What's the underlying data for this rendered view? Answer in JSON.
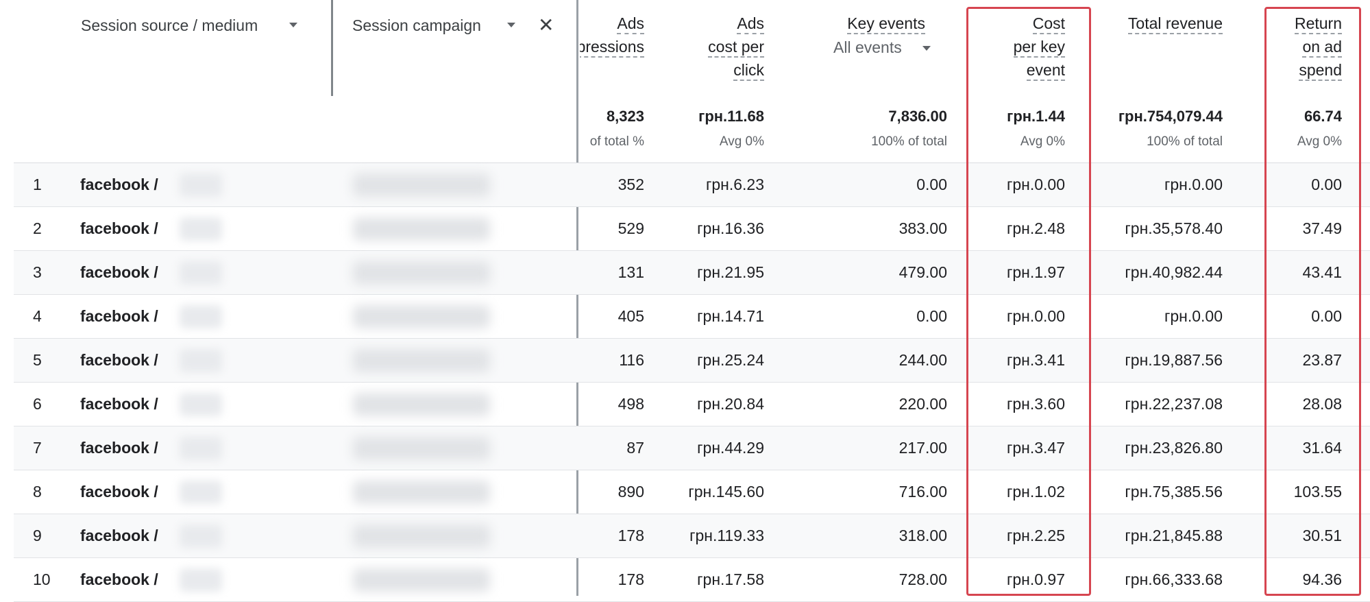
{
  "header": {
    "dim1_label": "Session source / medium",
    "dim2_label": "Session campaign",
    "remove_icon": "close-icon",
    "dropdown_icon": "caret-down-icon",
    "col_impressions": "pressions",
    "col_impressions_top": "Ads",
    "col_cpc": [
      "Ads",
      "cost per",
      "click"
    ],
    "col_key_events": "Key events",
    "key_events_selector": "All events",
    "col_cost_per_key": [
      "Cost",
      "per key",
      "event"
    ],
    "col_revenue": "Total revenue",
    "col_roas": [
      "Return",
      "on ad",
      "spend"
    ]
  },
  "totals": {
    "impressions": "8,323",
    "impressions_sub": "% of total",
    "cpc": "грн.11.68",
    "cpc_sub": "Avg 0%",
    "key_events": "7,836.00",
    "key_events_sub": "100% of total",
    "cost_per_key": "грн.1.44",
    "cost_per_key_sub": "Avg 0%",
    "revenue": "грн.754,079.44",
    "revenue_sub": "100% of total",
    "roas": "66.74",
    "roas_sub": "Avg 0%"
  },
  "rows": [
    {
      "n": "1",
      "source": "facebook /",
      "impressions": "352",
      "cpc": "грн.6.23",
      "key_events": "0.00",
      "cost_per_key": "грн.0.00",
      "revenue": "грн.0.00",
      "roas": "0.00"
    },
    {
      "n": "2",
      "source": "facebook /",
      "impressions": "529",
      "cpc": "грн.16.36",
      "key_events": "383.00",
      "cost_per_key": "грн.2.48",
      "revenue": "грн.35,578.40",
      "roas": "37.49"
    },
    {
      "n": "3",
      "source": "facebook /",
      "impressions": "131",
      "cpc": "грн.21.95",
      "key_events": "479.00",
      "cost_per_key": "грн.1.97",
      "revenue": "грн.40,982.44",
      "roas": "43.41"
    },
    {
      "n": "4",
      "source": "facebook /",
      "impressions": "405",
      "cpc": "грн.14.71",
      "key_events": "0.00",
      "cost_per_key": "грн.0.00",
      "revenue": "грн.0.00",
      "roas": "0.00"
    },
    {
      "n": "5",
      "source": "facebook /",
      "impressions": "116",
      "cpc": "грн.25.24",
      "key_events": "244.00",
      "cost_per_key": "грн.3.41",
      "revenue": "грн.19,887.56",
      "roas": "23.87"
    },
    {
      "n": "6",
      "source": "facebook /",
      "impressions": "498",
      "cpc": "грн.20.84",
      "key_events": "220.00",
      "cost_per_key": "грн.3.60",
      "revenue": "грн.22,237.08",
      "roas": "28.08"
    },
    {
      "n": "7",
      "source": "facebook /",
      "impressions": "87",
      "cpc": "грн.44.29",
      "key_events": "217.00",
      "cost_per_key": "грн.3.47",
      "revenue": "грн.23,826.80",
      "roas": "31.64"
    },
    {
      "n": "8",
      "source": "facebook /",
      "impressions": "890",
      "cpc": "грн.145.60",
      "key_events": "716.00",
      "cost_per_key": "грн.1.02",
      "revenue": "грн.75,385.56",
      "roas": "103.55"
    },
    {
      "n": "9",
      "source": "facebook /",
      "impressions": "178",
      "cpc": "грн.119.33",
      "key_events": "318.00",
      "cost_per_key": "грн.2.25",
      "revenue": "грн.21,845.88",
      "roas": "30.51"
    },
    {
      "n": "10",
      "source": "facebook /",
      "impressions": "178",
      "cpc": "грн.17.58",
      "key_events": "728.00",
      "cost_per_key": "грн.0.97",
      "revenue": "грн.66,333.68",
      "roas": "94.36"
    }
  ],
  "highlight_color": "#d64550"
}
